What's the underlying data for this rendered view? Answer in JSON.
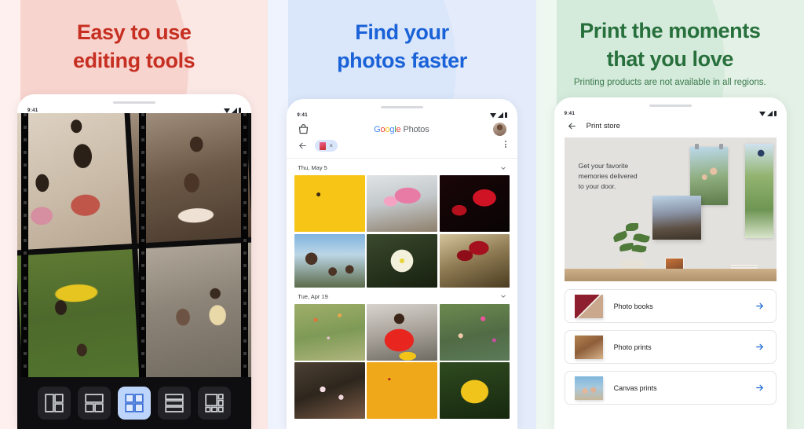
{
  "panels": [
    {
      "id": "editing-tools",
      "heading_line1": "Easy to use",
      "heading_line2": "editing tools",
      "heading_color": "#c62f21",
      "bg_color": "#fbe7e4",
      "phone": {
        "status_time": "9:41",
        "collage": {
          "photos": [
            "vintage-family-two-children",
            "vintage-children-in-tree",
            "vintage-child-tulip-garden",
            "vintage-grandmother-and-baby"
          ],
          "layout_options": [
            {
              "name": "layout-split-left",
              "selected": false
            },
            {
              "name": "layout-top-two-bottom",
              "selected": false
            },
            {
              "name": "layout-2x2-grid",
              "selected": true
            },
            {
              "name": "layout-three-rows",
              "selected": false
            },
            {
              "name": "layout-mosaic",
              "selected": false
            }
          ]
        }
      }
    },
    {
      "id": "find-photos",
      "heading_line1": "Find your",
      "heading_line2": "photos faster",
      "heading_color": "#1a62d8",
      "bg_color": "#e4ecfb",
      "phone": {
        "status_time": "9:41",
        "app": {
          "logo_google": [
            "G",
            "o",
            "o",
            "g",
            "l",
            "e"
          ],
          "logo_word": "Photos",
          "bag_icon": "shopping-bag-icon",
          "avatar": "user-avatar",
          "back_icon": "back-arrow-icon",
          "menu_icon": "overflow-menu-icon",
          "search_chip": {
            "label": "",
            "remove": "×"
          },
          "sections": [
            {
              "date": "Thu, May 5",
              "collapse_icon": "chevron-down-icon",
              "photos": [
                "sunflowers-in-vase",
                "pink-hydrangeas",
                "red-tulips",
                "three-friends-selfie",
                "white-zinnia-flower",
                "red-roses-bouquet"
              ]
            },
            {
              "date": "Tue, Apr 19",
              "collapse_icon": "chevron-down-icon",
              "photos": [
                "wildflower-meadow",
                "woman-in-red-with-flowers",
                "garden-pink-blooms",
                "pink-sedum-flowers",
                "gaillardia-daisies",
                "yellow-hibiscus"
              ]
            }
          ]
        }
      }
    },
    {
      "id": "print-store",
      "heading_line1": "Print the moments",
      "heading_line2": "that you love",
      "heading_color": "#27703c",
      "subnote": "Printing products are not available in all regions.",
      "bg_color": "#e3f1e6",
      "phone": {
        "status_time": "9:41",
        "app": {
          "back_icon": "back-arrow-icon",
          "title": "Print store",
          "banner": {
            "text": "Get your favorite\nmemories delivered\nto your door.",
            "imagery": [
              "hanging-poster-couple",
              "tall-wall-print-balloon",
              "canvas-mountain-print",
              "potted-plant",
              "small-framed-print",
              "stack-of-books"
            ]
          },
          "items": [
            {
              "label": "Photo books",
              "thumb": "photo-book-thumbnail",
              "arrow": "arrow-right-icon"
            },
            {
              "label": "Photo prints",
              "thumb": "photo-print-thumbnail",
              "arrow": "arrow-right-icon"
            },
            {
              "label": "Canvas prints",
              "thumb": "canvas-print-thumbnail",
              "arrow": "arrow-right-icon"
            }
          ]
        }
      }
    }
  ],
  "colors": {
    "accent_red": "#c62f21",
    "accent_blue": "#1a62d8",
    "accent_green": "#27703c",
    "arrow_blue": "#1967d2",
    "chip_blue": "#d9e5fb"
  }
}
